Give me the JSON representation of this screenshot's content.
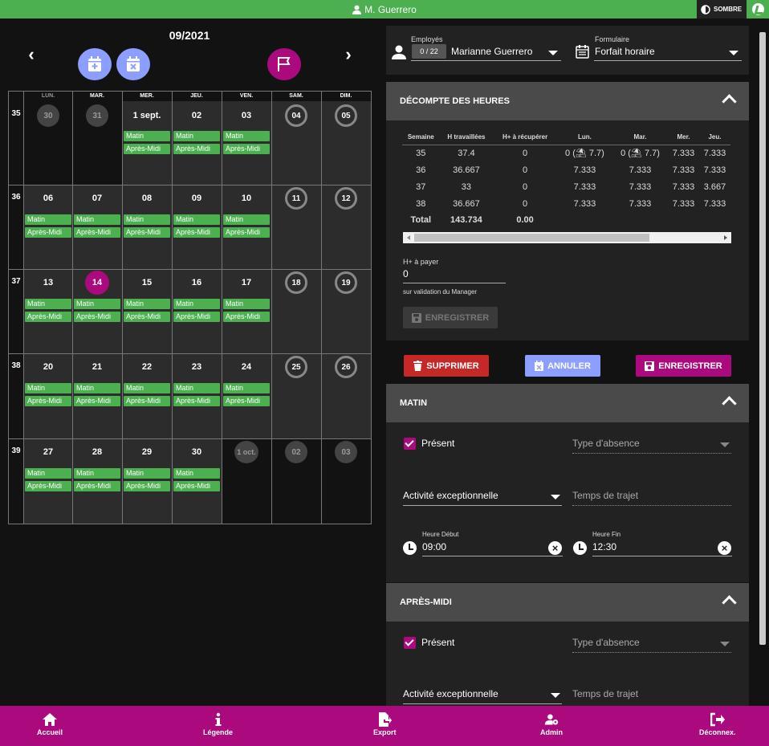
{
  "header": {
    "user": "M. Guerrero",
    "theme_label": "SOMBRE"
  },
  "calendar": {
    "month_title": "09/2021",
    "day_headers": [
      "LUN.",
      "MAR.",
      "MER.",
      "JEU.",
      "VEN.",
      "SAM.",
      "DIM."
    ],
    "weeks": [
      "35",
      "36",
      "37",
      "38",
      "39"
    ],
    "event_labels": {
      "morning": "Matin",
      "afternoon": "Après-Midi"
    }
  },
  "employee": {
    "label": "Employés",
    "counter": "0 / 22",
    "name": "Marianne Guerrero",
    "form_label": "Formulaire",
    "form_value": "Forfait horaire"
  },
  "tally": {
    "title": "DÉCOMPTE DES HEURES",
    "columns": [
      "Semaine",
      "H travaillées",
      "H+ à récupérer",
      "Lun.",
      "Mar.",
      "Mer.",
      "Jeu."
    ],
    "rows": [
      [
        "35",
        "37.4",
        "0",
        "0 (⛱ 7.7)",
        "0 (⛱ 7.7)",
        "7.333",
        "7.333"
      ],
      [
        "36",
        "36.667",
        "0",
        "7.333",
        "7.333",
        "7.333",
        "7.333"
      ],
      [
        "37",
        "33",
        "0",
        "7.333",
        "7.333",
        "7.333",
        "3.667"
      ],
      [
        "38",
        "36.667",
        "0",
        "7.333",
        "7.333",
        "7.333",
        "7.333"
      ]
    ],
    "total": [
      "Total",
      "143.734",
      "0.00"
    ],
    "pay_label": "H+ à payer",
    "pay_value": "0",
    "pay_help": "sur validation du Manager",
    "save_label": "ENREGISTRER"
  },
  "actions": {
    "delete": "SUPPRIMER",
    "cancel": "ANNULER",
    "save": "ENREGISTRER"
  },
  "morning": {
    "title": "MATIN",
    "present": "Présent",
    "absence_type": "Type d'absence",
    "activity": "Activité exceptionnelle",
    "travel": "Temps de trajet",
    "start_label": "Heure Début",
    "start_value": "09:00",
    "end_label": "Heure Fin",
    "end_value": "12:30"
  },
  "afternoon": {
    "title": "APRÈS-MIDI",
    "present": "Présent",
    "absence_type": "Type d'absence",
    "activity": "Activité exceptionnelle",
    "travel": "Temps de trajet"
  },
  "bottom_nav": {
    "home": "Accueil",
    "legend": "Légende",
    "export": "Export",
    "admin": "Admin",
    "logout": "Déconnex."
  },
  "colors": {
    "green": "#4caf50",
    "magenta": "#ab0a7e",
    "lavender": "#8c9eff",
    "red": "#c62828"
  }
}
